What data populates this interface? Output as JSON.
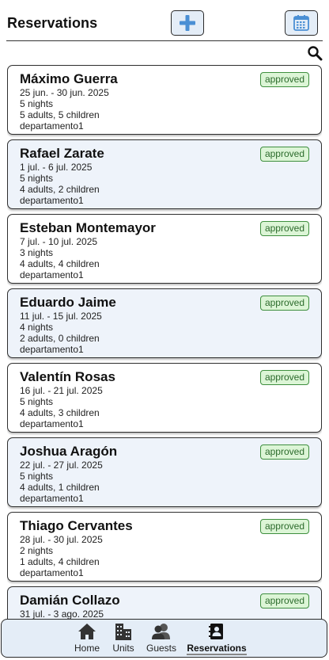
{
  "header": {
    "title": "Reservations",
    "add_icon": "plus-icon",
    "calendar_icon": "calendar-icon",
    "search_icon": "search-icon"
  },
  "colors": {
    "accent": "#4a8fd4",
    "button_bg": "#e4edf7",
    "alt_card_bg": "#eef3fa",
    "badge_bg": "#dcf5d6",
    "badge_border": "#3f8f3f"
  },
  "reservations": [
    {
      "guest": "Máximo Guerra",
      "dates": "25 jun. - 30 jun. 2025",
      "nights": "5 nights",
      "party": "5 adults, 5 children",
      "unit": "departamento1",
      "status": "approved"
    },
    {
      "guest": "Rafael Zarate",
      "dates": "1 jul. - 6 jul. 2025",
      "nights": "5 nights",
      "party": "4 adults, 2 children",
      "unit": "departamento1",
      "status": "approved"
    },
    {
      "guest": "Esteban Montemayor",
      "dates": "7 jul. - 10 jul. 2025",
      "nights": "3 nights",
      "party": "4 adults, 4 children",
      "unit": "departamento1",
      "status": "approved"
    },
    {
      "guest": "Eduardo Jaime",
      "dates": "11 jul. - 15 jul. 2025",
      "nights": "4 nights",
      "party": "2 adults, 0 children",
      "unit": "departamento1",
      "status": "approved"
    },
    {
      "guest": "Valentín Rosas",
      "dates": "16 jul. - 21 jul. 2025",
      "nights": "5 nights",
      "party": "4 adults, 3 children",
      "unit": "departamento1",
      "status": "approved"
    },
    {
      "guest": "Joshua Aragón",
      "dates": "22 jul. - 27 jul. 2025",
      "nights": "5 nights",
      "party": "4 adults, 1 children",
      "unit": "departamento1",
      "status": "approved"
    },
    {
      "guest": "Thiago Cervantes",
      "dates": "28 jul. - 30 jul. 2025",
      "nights": "2 nights",
      "party": "1 adults, 4 children",
      "unit": "departamento1",
      "status": "approved"
    },
    {
      "guest": "Damián Collazo",
      "dates": "31 jul. - 3 ago. 2025",
      "nights": "",
      "party": "",
      "unit": "",
      "status": "approved"
    }
  ],
  "bottom_nav": [
    {
      "label": "Home",
      "icon": "home-icon"
    },
    {
      "label": "Units",
      "icon": "building-icon"
    },
    {
      "label": "Guests",
      "icon": "guests-icon"
    },
    {
      "label": "Reservations",
      "icon": "reservations-icon",
      "active": true
    }
  ]
}
